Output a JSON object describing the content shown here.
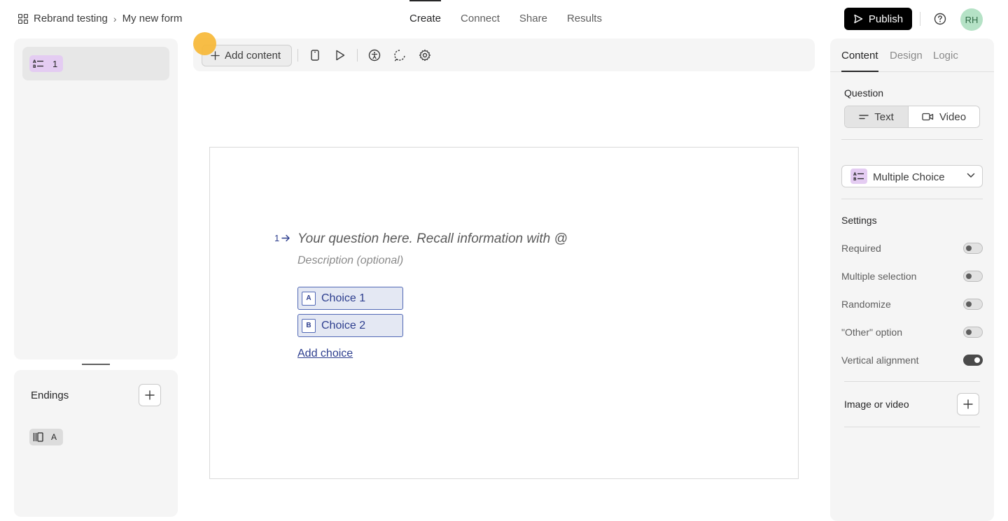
{
  "header": {
    "breadcrumb": [
      "Rebrand testing",
      "My new form"
    ],
    "nav": [
      "Create",
      "Connect",
      "Share",
      "Results"
    ],
    "active_nav": "Create",
    "publish_label": "Publish",
    "avatar_initials": "RH"
  },
  "sidebar": {
    "question_item": {
      "number": "1",
      "icon": "multiple-choice-icon"
    },
    "endings_title": "Endings",
    "ending_item": {
      "label": "A",
      "icon": "ending-icon"
    }
  },
  "toolbar": {
    "add_content_label": "Add content",
    "icons": [
      "mobile-preview-icon",
      "play-icon",
      "accessibility-icon",
      "loop-icon",
      "settings-icon"
    ]
  },
  "canvas": {
    "question_number": "1",
    "question_placeholder": "Your question here. Recall information with @",
    "description_placeholder": "Description (optional)",
    "choices": [
      {
        "key": "A",
        "label": "Choice 1"
      },
      {
        "key": "B",
        "label": "Choice 2"
      }
    ],
    "add_choice_label": "Add choice"
  },
  "panel": {
    "tabs": [
      "Content",
      "Design",
      "Logic"
    ],
    "active_tab": "Content",
    "question_label": "Question",
    "question_modes": [
      "Text",
      "Video"
    ],
    "active_mode": "Text",
    "question_type": "Multiple Choice",
    "settings_label": "Settings",
    "settings": [
      {
        "label": "Required",
        "on": false
      },
      {
        "label": "Multiple selection",
        "on": false
      },
      {
        "label": "Randomize",
        "on": false
      },
      {
        "label": "\"Other\" option",
        "on": false
      },
      {
        "label": "Vertical alignment",
        "on": true
      }
    ],
    "media_label": "Image or video"
  },
  "colors": {
    "accent_blue": "#2d3e8e",
    "choice_fill": "#e4e8f3",
    "question_badge": "#e4ccf2",
    "avatar_bg": "#b5e2c6",
    "cursor_highlight": "#f7b733"
  }
}
